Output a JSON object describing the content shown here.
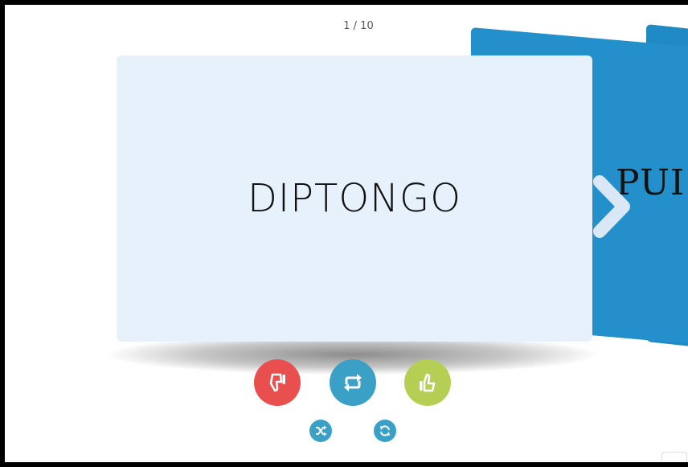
{
  "flashcards": {
    "counter": "1 / 10",
    "current_card": {
      "text": "DIPTONGO"
    },
    "next_card": {
      "text": "PUI"
    }
  },
  "controls": {
    "dislike": {
      "icon": "thumbs-down-icon",
      "color": "#e94f4f"
    },
    "flip": {
      "icon": "repeat-icon",
      "color": "#3aa0c6"
    },
    "like": {
      "icon": "thumbs-up-icon",
      "color": "#b5cf55"
    },
    "shuffle": {
      "icon": "shuffle-icon",
      "color": "#3aa0c6"
    },
    "restart": {
      "icon": "refresh-icon",
      "color": "#3aa0c6"
    }
  },
  "colors": {
    "card_front": "#e6f1fc",
    "card_back": "#2490cb",
    "frame_border": "#000000"
  }
}
